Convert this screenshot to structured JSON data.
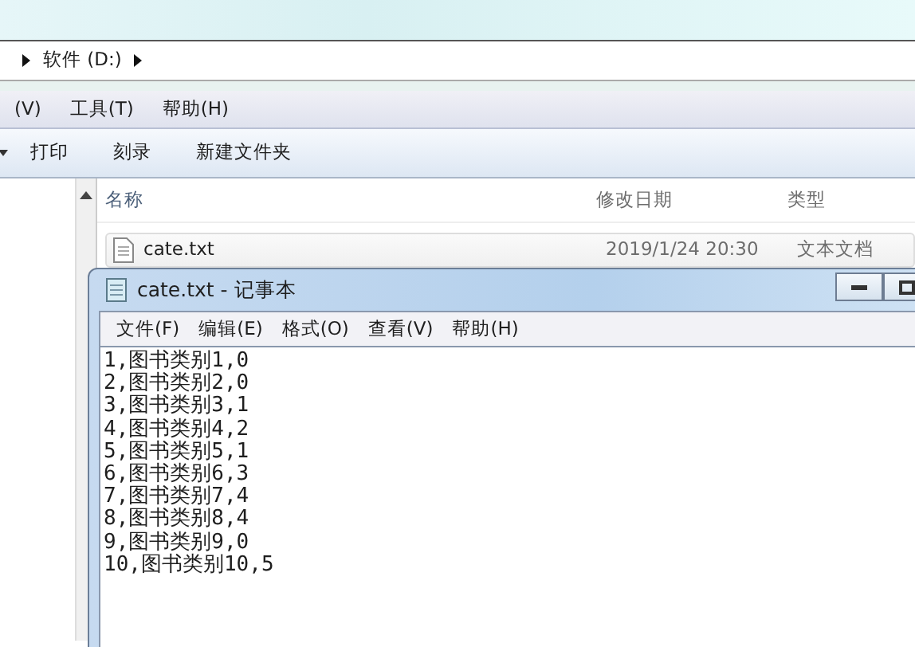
{
  "explorer": {
    "address_path": [
      "软件 (D:)"
    ],
    "menu": [
      "(V)",
      "工具(T)",
      "帮助(H)"
    ],
    "toolbar": [
      "打印",
      "刻录",
      "新建文件夹"
    ],
    "columns": [
      "名称",
      "修改日期",
      "类型"
    ],
    "files": [
      {
        "name": "cate.txt",
        "modified": "2019/1/24 20:30",
        "type": "文本文档",
        "selected": false
      }
    ]
  },
  "notepad": {
    "title": "cate.txt - 记事本",
    "menu": [
      "文件(F)",
      "编辑(E)",
      "格式(O)",
      "查看(V)",
      "帮助(H)"
    ],
    "lines": [
      "1,图书类别1,0",
      "2,图书类别2,0",
      "3,图书类别3,1",
      "4,图书类别4,2",
      "5,图书类别5,1",
      "6,图书类别6,3",
      "7,图书类别7,4",
      "8,图书类别8,4",
      "9,图书类别9,0",
      "10,图书类别10,5"
    ]
  }
}
